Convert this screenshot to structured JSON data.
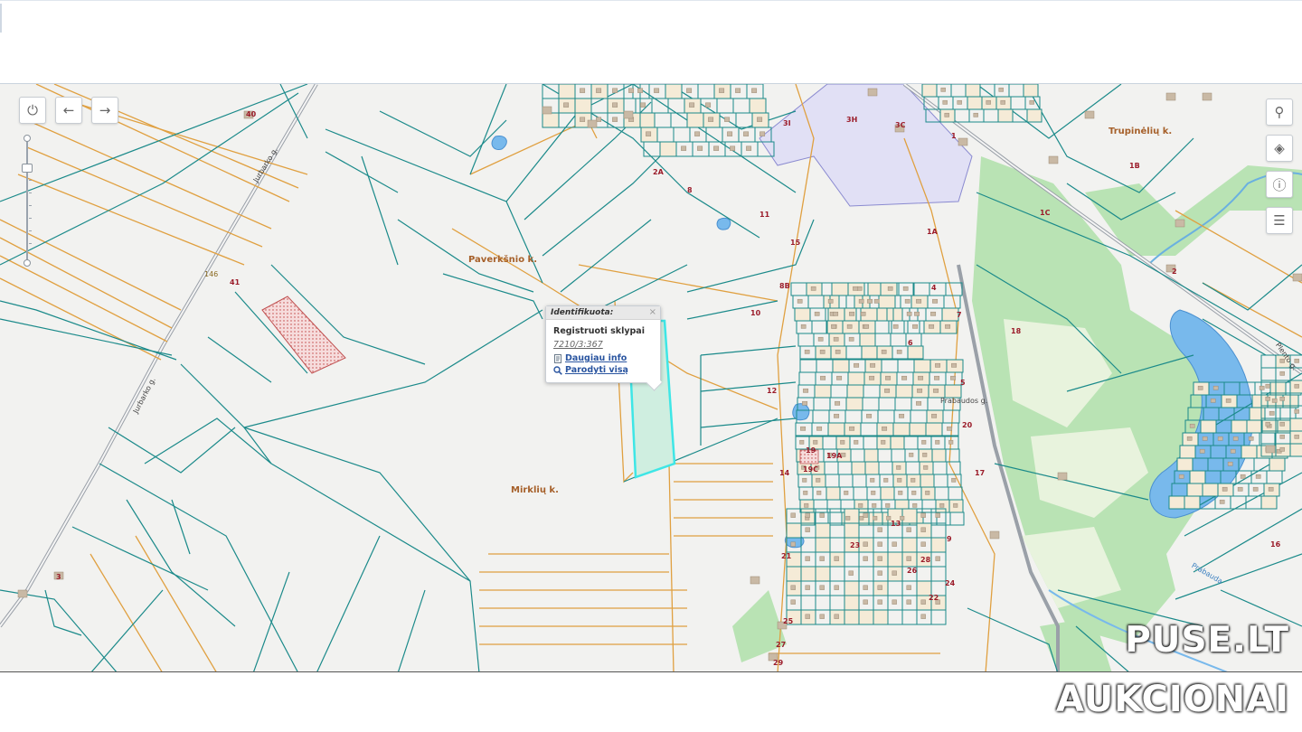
{
  "colors": {
    "map_background": "#f2f2f0",
    "parcel_outline": "#1b8a8a",
    "road_outline": "#e0a040",
    "forest": "#b9e3b4",
    "water": "#78b9ec",
    "industrial": "#e1e0f5",
    "selection": "#3ee6e6",
    "watermark_text": "#ffffff"
  },
  "map_controls": {
    "power": {
      "icon": "power-icon",
      "glyph": "⏻"
    },
    "back": {
      "icon": "arrow-left-icon",
      "glyph": "←"
    },
    "forward": {
      "icon": "arrow-right-icon",
      "glyph": "→"
    },
    "search": {
      "icon": "search-icon",
      "glyph": "⚲"
    },
    "layers": {
      "icon": "layers-icon",
      "glyph": "◈"
    },
    "info": {
      "icon": "info-icon",
      "glyph": "ⓘ"
    },
    "legend": {
      "icon": "legend-icon",
      "glyph": "☰"
    }
  },
  "places": {
    "paverksnio": "Paverkšnio k.",
    "mirkliu": "Mirklių k.",
    "trupineliu": "Trupinėlių k."
  },
  "roads": {
    "jurbarko_upper": "Jurbarko g.",
    "jurbarko_lower": "Jurbarko g.",
    "pleno": "Plento g.",
    "prabaudos": "Prabaudos g.",
    "prabauda": "Prabauda",
    "road_number": "146"
  },
  "popup": {
    "title": "Identifikuota:",
    "close": "×",
    "layer": "Registruoti sklypai",
    "parcel_id": "7210/3:367",
    "more_info": "Daugiau info",
    "show_all": "Parodyti visą"
  },
  "parcel_numbers": [
    "40",
    "41",
    "3",
    "12",
    "18",
    "1",
    "1A",
    "1B",
    "1C",
    "3C",
    "3H",
    "3I",
    "2",
    "2A",
    "8",
    "8B",
    "10",
    "14",
    "19",
    "19A",
    "19C",
    "21",
    "25",
    "27",
    "29",
    "13",
    "23",
    "17",
    "9",
    "6",
    "7",
    "4",
    "5",
    "11",
    "15",
    "16",
    "20",
    "22",
    "24",
    "26",
    "28"
  ],
  "watermark": {
    "line1": "PUSE.LT",
    "line2": "AUKCIONAI"
  }
}
